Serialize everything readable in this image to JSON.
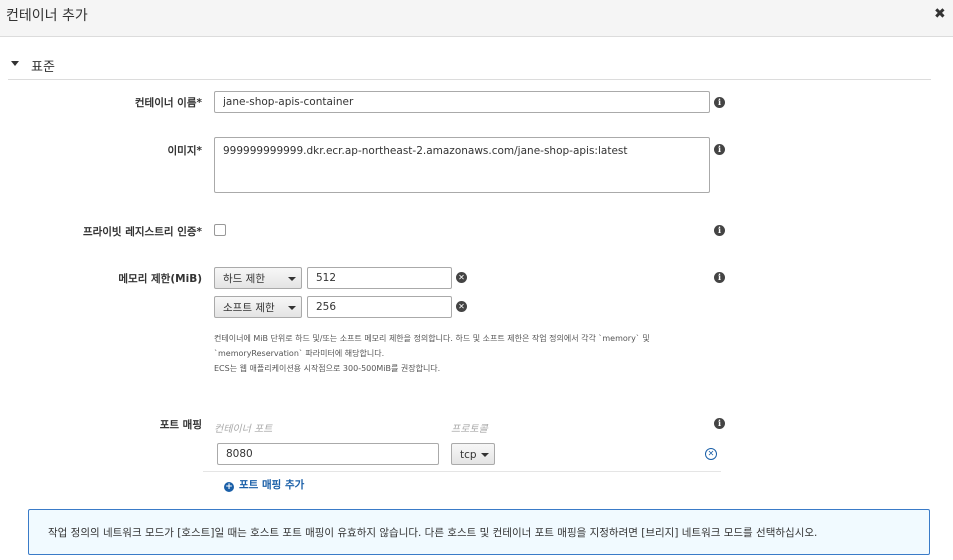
{
  "header": {
    "title": "컨테이너 추가",
    "close_icon": "✖"
  },
  "section": {
    "title": "표준"
  },
  "container_name": {
    "label": "컨테이너 이름*",
    "value": "jane-shop-apis-container"
  },
  "image": {
    "label": "이미지*",
    "value": "999999999999.dkr.ecr.ap-northeast-2.amazonaws.com/jane-shop-apis:latest"
  },
  "private_registry": {
    "label": "프라이빗 레지스트리 인증*",
    "checked": false
  },
  "memory": {
    "label": "메모리 제한(MiB)",
    "hard": {
      "type": "하드 제한",
      "value": "512"
    },
    "soft": {
      "type": "소프트 제한",
      "value": "256"
    },
    "help_lines": [
      "컨테이너에 MiB 단위로 하드 및/또는 소프트 메모리 제한을 정의합니다. 하드 및 소프트 제한은 작업 정의에서 각각 `memory` 및",
      "`memoryReservation` 파라미터에 해당합니다.",
      "ECS는 웹 애플리케이션용 시작점으로 300-500MiB를 권장합니다."
    ]
  },
  "port_mapping": {
    "label": "포트 매핑",
    "col_container_port": "컨테이너 포트",
    "col_protocol": "프로토콜",
    "rows": [
      {
        "container_port": "8080",
        "protocol": "tcp"
      }
    ],
    "add_label": "포트 매핑 추가"
  },
  "notice": {
    "text": "작업 정의의 네트워크 모드가 [호스트]일 때는 호스트 포트 매핑이 유효하지 않습니다. 다른 호스트 및 컨테이너 포트 매핑을 지정하려면 [브리지] 네트워크 모드를 선택하십시오."
  },
  "colors": {
    "link": "#1a5fa8",
    "notice_border": "#3a7bc8",
    "notice_bg": "#f1faff"
  }
}
